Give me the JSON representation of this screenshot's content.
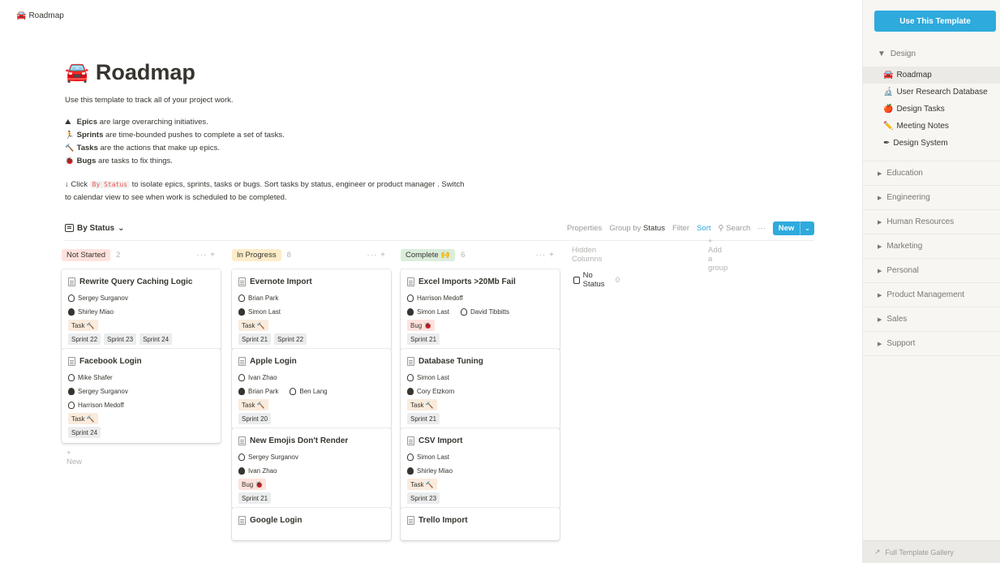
{
  "breadcrumb": {
    "icon": "🚘",
    "label": "Roadmap"
  },
  "page": {
    "icon": "🚘",
    "title": "Roadmap",
    "description": "Use this template to track all of your project work.",
    "bullets": [
      {
        "icon": "⛰",
        "bold": "Epics",
        "rest": " are large overarching initiatives."
      },
      {
        "icon": "🏃",
        "bold": "Sprints",
        "rest": " are time-bounded pushes to complete a set of tasks."
      },
      {
        "icon": "🔨",
        "bold": "Tasks",
        "rest": " are the actions that make up epics."
      },
      {
        "icon": "🐞",
        "bold": "Bugs",
        "rest": " are tasks to fix things."
      }
    ],
    "instruction": {
      "prefix": "↓ Click ",
      "code": "By Status",
      "line1": " to isolate epics, sprints, tasks or bugs. Sort tasks by status, engineer or product manager . Switch",
      "line2": "to calendar view to see when work is scheduled to be completed."
    }
  },
  "view": {
    "name": "By Status",
    "caret": "⌄",
    "properties": "Properties",
    "group_by_label": "Group by",
    "group_by_value": "Status",
    "filter": "Filter",
    "sort": "Sort",
    "search": "Search",
    "more": "···",
    "new": "New",
    "new_caret": "⌄"
  },
  "columns": [
    {
      "name": "Not Started",
      "count": "2",
      "color": "#ffe2dd",
      "emoji": ""
    },
    {
      "name": "In Progress",
      "count": "8",
      "color": "#fdecc8",
      "emoji": ""
    },
    {
      "name": "Complete",
      "count": "6",
      "color": "#dbeddb",
      "emoji": "🙌"
    }
  ],
  "column_tools": "··· +",
  "new_card": "+ New",
  "hidden_columns": "Hidden Columns",
  "add_group": "+ Add a group",
  "no_status": {
    "label": "No Status",
    "count": "0"
  },
  "cards": {
    "col0": [
      {
        "title": "Rewrite Query Caching Logic",
        "people": [
          "Sergey Surganov",
          "Shirley Miao"
        ],
        "type": "Task 🔨",
        "sprints": [
          "Sprint 22",
          "Sprint 23",
          "Sprint 24"
        ]
      },
      {
        "title": "Facebook Login",
        "people": [
          "Mike Shafer",
          "Sergey Surganov",
          "Harrison Medoff"
        ],
        "type": "Task 🔨",
        "sprints": [
          "Sprint 24"
        ]
      }
    ],
    "col1": [
      {
        "title": "Evernote Import",
        "people": [
          "Brian Park",
          "Simon Last"
        ],
        "type": "Task 🔨",
        "sprints": [
          "Sprint 21",
          "Sprint 22"
        ]
      },
      {
        "title": "Apple Login",
        "people": [
          "Ivan Zhao",
          "Brian Park",
          "Ben Lang"
        ],
        "type": "Task 🔨",
        "sprints": [
          "Sprint 20"
        ]
      },
      {
        "title": "New Emojis Don't Render",
        "people": [
          "Sergey Surganov",
          "Ivan Zhao"
        ],
        "type": "Bug 🐞",
        "sprints": [
          "Sprint 21"
        ]
      },
      {
        "title": "Google Login"
      }
    ],
    "col2": [
      {
        "title": "Excel Imports >20Mb Fail",
        "people": [
          "Harrison Medoff",
          "Simon Last",
          "David Tibbitts"
        ],
        "type": "Bug 🐞",
        "sprints": [
          "Sprint 21"
        ]
      },
      {
        "title": "Database Tuning",
        "people": [
          "Simon Last",
          "Cory Etzkorn"
        ],
        "type": "Task 🔨",
        "sprints": [
          "Sprint 21"
        ]
      },
      {
        "title": "CSV Import",
        "people": [
          "Simon Last",
          "Shirley Miao"
        ],
        "type": "Task 🔨",
        "sprints": [
          "Sprint 23"
        ]
      },
      {
        "title": "Trello Import"
      }
    ]
  },
  "sidebar": {
    "use_template": "Use This Template",
    "design": {
      "label": "Design",
      "arrow": "▼"
    },
    "design_items": [
      {
        "icon": "🚘",
        "label": "Roadmap"
      },
      {
        "icon": "🔬",
        "label": "User Research Database"
      },
      {
        "icon": "🍎",
        "label": "Design Tasks"
      },
      {
        "icon": "✏️",
        "label": "Meeting Notes"
      },
      {
        "icon": "✒",
        "label": "Design System"
      }
    ],
    "sections": [
      "Education",
      "Engineering",
      "Human Resources",
      "Marketing",
      "Personal",
      "Product Management",
      "Sales",
      "Support"
    ],
    "section_arrow": "▶",
    "footer_icon": "↗",
    "footer": "Full Template Gallery"
  }
}
